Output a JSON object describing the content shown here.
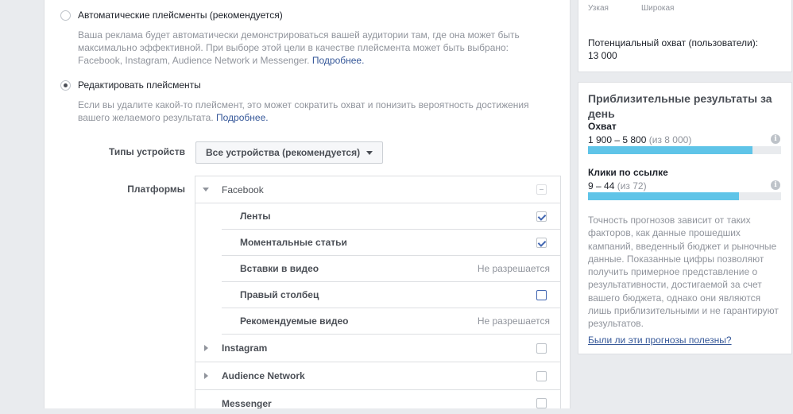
{
  "placements": {
    "auto": {
      "label": "Автоматические плейсменты (рекомендуется)",
      "description": "Ваша реклама будет автоматически демонстрироваться вашей аудитории там, где она может быть максимально эффективной. При выборе этой цели в качестве плейсмента может быть выбрано: Facebook, Instagram, Audience Network и Messenger. ",
      "more_link": "Подробнее."
    },
    "edit": {
      "label": "Редактировать плейсменты",
      "description": "Если вы удалите какой-то плейсмент, это может сократить охват и понизить вероятность достижения вашего желаемого результата. ",
      "more_link": "Подробнее."
    }
  },
  "device_types": {
    "label": "Типы устройств",
    "selected": "Все устройства (рекомендуется)"
  },
  "platforms": {
    "label": "Платформы",
    "facebook": {
      "name": "Facebook",
      "items": [
        {
          "name": "Ленты",
          "state": "checked"
        },
        {
          "name": "Моментальные статьи",
          "state": "checked"
        },
        {
          "name": "Вставки в видео",
          "state": "Не разрешается"
        },
        {
          "name": "Правый столбец",
          "state": "unchecked"
        },
        {
          "name": "Рекомендуемые видео",
          "state": "Не разрешается"
        }
      ]
    },
    "others": [
      {
        "name": "Instagram"
      },
      {
        "name": "Audience Network"
      },
      {
        "name": "Messenger"
      }
    ]
  },
  "audience": {
    "narrow": "Узкая",
    "wide": "Широкая",
    "potential_reach_label": "Потенциальный охват (пользователи):",
    "potential_reach_value": "13 000"
  },
  "estimates": {
    "title": "Приблизительные результаты за день",
    "reach": {
      "label": "Охват",
      "range": "1 900 – 5 800",
      "of": "(из 8 000)",
      "fill_percent": 85
    },
    "clicks": {
      "label": "Клики по ссылке",
      "range": "9 – 44",
      "of": "(из 72)",
      "fill_percent": 78
    },
    "accuracy_note": "Точность прогнозов зависит от таких факторов, как данные прошедших кампаний, введенный бюджет и рыночные данные. Показанные цифры позволяют получить примерное представление о результативности, достигаемой за счет вашего бюджета, однако они являются лишь приблизительными и не гарантируют результатов.",
    "feedback_link": "Были ли эти прогнозы полезны?",
    "info_glyph": "i"
  },
  "colors": {
    "accent": "#4267b2",
    "bar_fill": "#5fc4e8",
    "link": "#365899"
  }
}
